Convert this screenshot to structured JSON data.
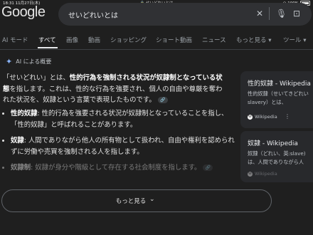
{
  "status": {
    "time": "18:31",
    "date": "11月27日(木)",
    "url": "せいどれいとは",
    "battery": "100%"
  },
  "logo": "Google",
  "search": {
    "query": "せいどれいとは"
  },
  "tabs": [
    "AI モード",
    "すべて",
    "画像",
    "動画",
    "ショッピング",
    "ショート動画",
    "ニュース",
    "もっと見る ▾",
    "ツール ▾"
  ],
  "ai_overview": {
    "heading": "AI による概要",
    "p1": "「せいどれい」とは、",
    "p1_bold": "性的行為を強制される状況が奴隷制となっている状態",
    "p1_rest": "を指します。これは、性的な行為を強要され、個人の自由や尊厳を奪われた状況を、奴隷という言葉で表現したものです。",
    "bullets": [
      {
        "term": "性的奴隷",
        "text": ": 性的行為を強要される状況が奴隷制となっていることを指し、「性的奴隷」と呼ばれることがあります。"
      },
      {
        "term": "奴隷",
        "text": ": 人間でありながら他人の所有物として扱われ、自由や権利を認められずに労働や売買を強制される人を指します。"
      },
      {
        "term": "奴隷制",
        "text": ": 奴隷が身分や階級として存在する社会制度を指します。"
      }
    ],
    "more_label": "もっと見る"
  },
  "cards": [
    {
      "title": "性的奴隷 - Wikipedia",
      "desc1": "性的奴隷（せいてきどれい",
      "desc2": "slavery）とは、",
      "source": "Wikipedia"
    },
    {
      "title": "奴隷 - Wikipedia",
      "desc1": "奴隷（どれい、英:slave)",
      "desc2": "は、人間でありながら人",
      "source": "Wikipedia"
    }
  ]
}
